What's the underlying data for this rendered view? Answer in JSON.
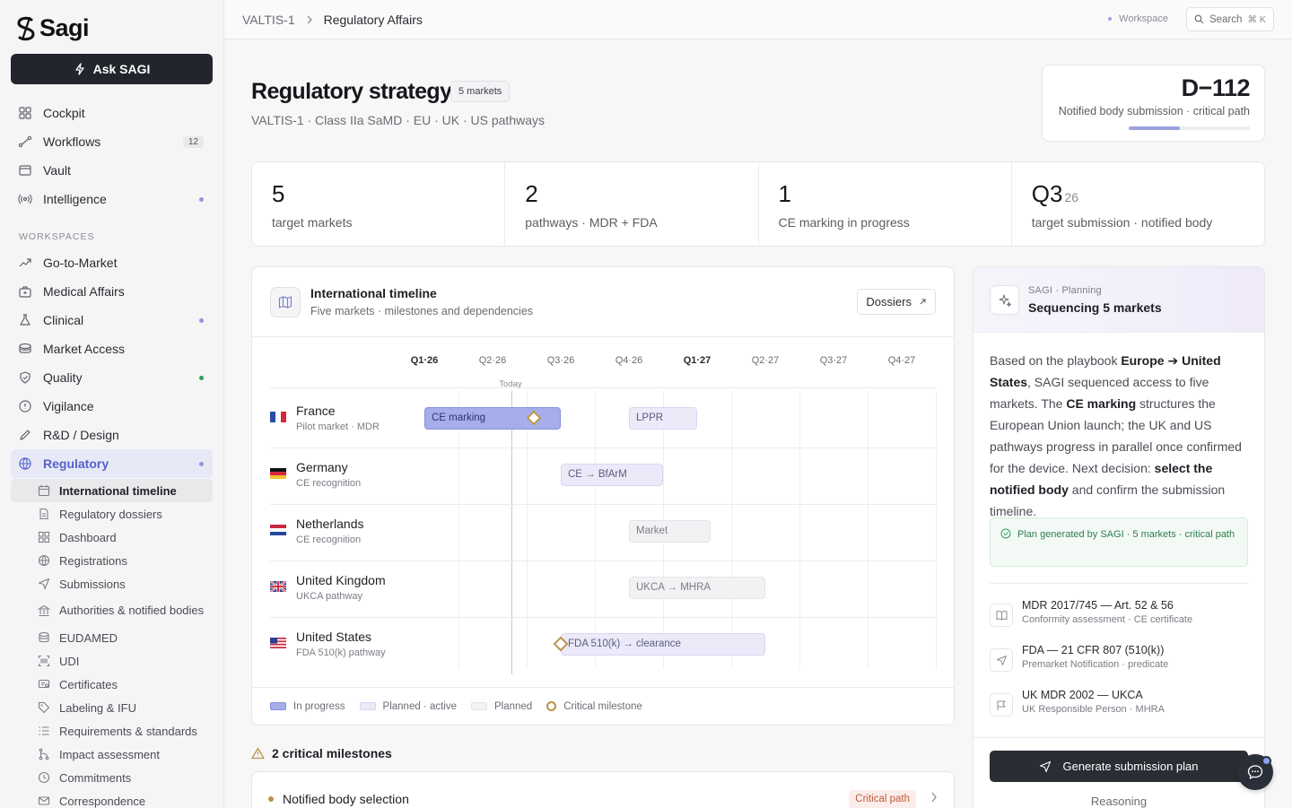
{
  "app": {
    "name": "Sagi",
    "ask_label": "Ask SAGI"
  },
  "nav": [
    {
      "label": "Cockpit",
      "icon": "grid-icon"
    },
    {
      "label": "Workflows",
      "icon": "workflow-icon",
      "badge": "12"
    },
    {
      "label": "Vault",
      "icon": "vault-icon"
    },
    {
      "label": "Intelligence",
      "icon": "signal-icon",
      "dot": "#8f99e0"
    }
  ],
  "workspaces_label": "WORKSPACES",
  "workspaces": [
    {
      "label": "Go-to-Market",
      "icon": "trend-icon"
    },
    {
      "label": "Medical Affairs",
      "icon": "briefcase-icon"
    },
    {
      "label": "Clinical",
      "icon": "flask-icon",
      "dot": "#8f99e0"
    },
    {
      "label": "Market Access",
      "icon": "coins-icon"
    },
    {
      "label": "Quality",
      "icon": "shield-icon",
      "dot": "#2f9e5b"
    },
    {
      "label": "Vigilance",
      "icon": "alert-icon"
    },
    {
      "label": "R&D / Design",
      "icon": "pen-icon"
    },
    {
      "label": "Regulatory",
      "icon": "globe-icon",
      "dot": "#8f99e0"
    }
  ],
  "subnav": [
    {
      "label": "International timeline",
      "icon": "calendar-icon"
    },
    {
      "label": "Regulatory dossiers",
      "icon": "file-icon"
    },
    {
      "label": "Dashboard",
      "icon": "grid-icon"
    },
    {
      "label": "Registrations",
      "icon": "globe-icon"
    },
    {
      "label": "Submissions",
      "icon": "send-icon"
    },
    {
      "label": "Authorities & notified bodies",
      "icon": "bank-icon"
    },
    {
      "label": "EUDAMED",
      "icon": "database-icon"
    },
    {
      "label": "UDI",
      "icon": "barcode-icon"
    },
    {
      "label": "Certificates",
      "icon": "certificate-icon"
    },
    {
      "label": "Labeling & IFU",
      "icon": "tag-icon"
    },
    {
      "label": "Requirements & standards",
      "icon": "list-icon"
    },
    {
      "label": "Impact assessment",
      "icon": "branch-icon"
    },
    {
      "label": "Commitments",
      "icon": "clock-icon"
    },
    {
      "label": "Correspondence",
      "icon": "mail-icon"
    }
  ],
  "topbar": {
    "crumb_root": "VALTIS-1",
    "crumb_current": "Regulatory Affairs",
    "workspace": "Workspace",
    "search": "Search",
    "search_kbd": "⌘ K"
  },
  "header": {
    "title": "Regulatory strategy",
    "pill": "5 markets",
    "subtitle": "VALTIS-1 · Class IIa SaMD · EU · UK · US pathways"
  },
  "deadline": {
    "value": "D−112",
    "label": "Notified body submission · critical path",
    "progress": 0.42
  },
  "stats": [
    {
      "value": "5",
      "suffix": "",
      "label": "target markets"
    },
    {
      "value": "2",
      "suffix": "",
      "label": "pathways · MDR + FDA"
    },
    {
      "value": "1",
      "suffix": "",
      "label": "CE marking in progress"
    },
    {
      "value": "Q3",
      "suffix": "26",
      "label": "target submission · notified body"
    }
  ],
  "timeline": {
    "title": "International timeline",
    "subtitle": "Five markets · milestones and dependencies",
    "dossiers": "Dossiers",
    "today": "Today",
    "quarters": [
      "Q1·26",
      "Q2·26",
      "Q3·26",
      "Q4·26",
      "Q1·27",
      "Q2·27",
      "Q3·27",
      "Q4·27"
    ],
    "rows": [
      {
        "country": "France",
        "sub": "Pilot market · MDR",
        "flag": "fr",
        "bars": [
          {
            "label": "CE marking",
            "kind": "prog",
            "start": 0.5,
            "end": 2.5
          },
          {
            "label": "LPPR",
            "kind": "active",
            "start": 3.5,
            "end": 4.5
          }
        ],
        "milestones": [
          2.1
        ]
      },
      {
        "country": "Germany",
        "sub": "CE recognition",
        "flag": "de",
        "bars": [
          {
            "label": "CE → BfArM",
            "kind": "active",
            "start": 2.5,
            "end": 4.0
          }
        ],
        "milestones": []
      },
      {
        "country": "Netherlands",
        "sub": "CE recognition",
        "flag": "nl",
        "bars": [
          {
            "label": "Market",
            "kind": "plan",
            "start": 3.5,
            "end": 4.7
          }
        ],
        "milestones": []
      },
      {
        "country": "United Kingdom",
        "sub": "UKCA pathway",
        "flag": "uk",
        "bars": [
          {
            "label": "UKCA → MHRA",
            "kind": "plan",
            "start": 3.5,
            "end": 5.5
          }
        ],
        "milestones": []
      },
      {
        "country": "United States",
        "sub": "FDA 510(k) pathway",
        "flag": "us",
        "bars": [
          {
            "label": "FDA 510(k) → clearance",
            "kind": "active",
            "start": 2.5,
            "end": 5.5
          }
        ],
        "milestones": [
          2.5
        ]
      }
    ],
    "legend": {
      "in_progress": "In progress",
      "planned_active": "Planned · active",
      "planned": "Planned",
      "critical": "Critical milestone"
    }
  },
  "critical": {
    "heading": "2 critical milestones",
    "item": "Notified body selection",
    "tag": "Critical path"
  },
  "sagi": {
    "kicker": "SAGI · Planning",
    "title": "Sequencing 5 markets",
    "body": [
      {
        "t": "Based on the playbook "
      },
      {
        "b": "Europe ➔ United States"
      },
      {
        "t": ", SAGI sequenced access to five markets. The "
      },
      {
        "b": "CE marking"
      },
      {
        "t": " structures the European Union launch; the UK and US pathways progress in parallel once confirmed for the device. Next decision: "
      },
      {
        "b": "select the notified body"
      },
      {
        "t": " and confirm the submission timeline."
      }
    ],
    "generated": "Plan generated by SAGI · 5 markets · critical path",
    "refs": [
      {
        "title": "MDR 2017/745 — Art. 52 & 56",
        "sub": "Conformity assessment · CE certificate",
        "icon": "book-icon"
      },
      {
        "title": "FDA — 21 CFR 807 (510(k))",
        "sub": "Premarket Notification · predicate",
        "icon": "send-icon"
      },
      {
        "title": "UK MDR 2002 — UKCA",
        "sub": "UK Responsible Person · MHRA",
        "icon": "flag-icon"
      }
    ],
    "button": "Generate submission plan",
    "reasoning": "Reasoning"
  }
}
